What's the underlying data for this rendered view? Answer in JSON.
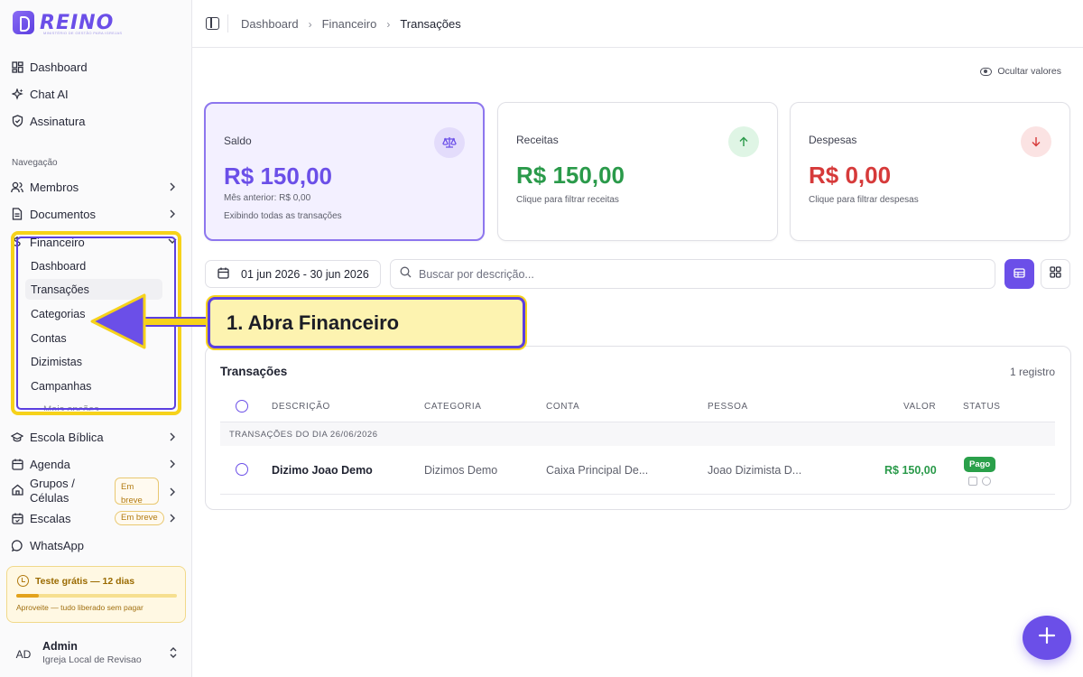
{
  "app": {
    "logo_text": "REINO",
    "logo_sub": "MINISTÉRIO DE GESTÃO PARA IGREJAS"
  },
  "sidebar": {
    "top_items": [
      {
        "label": "Dashboard",
        "icon": "grid-icon"
      },
      {
        "label": "Chat AI",
        "icon": "sparkles-icon"
      },
      {
        "label": "Assinatura",
        "icon": "shield-check-icon"
      }
    ],
    "section_label": "Navegação",
    "nav_items": [
      {
        "label": "Membros",
        "icon": "users-icon"
      },
      {
        "label": "Documentos",
        "icon": "file-icon"
      },
      {
        "label": "Financeiro",
        "icon": "dollar-icon"
      }
    ],
    "financeiro_sub": [
      {
        "label": "Dashboard"
      },
      {
        "label": "Transações"
      },
      {
        "label": "Categorias"
      },
      {
        "label": "Contas"
      },
      {
        "label": "Dizimistas"
      },
      {
        "label": "Campanhas"
      }
    ],
    "sub_faded": "Mais opções",
    "lower_items": [
      {
        "label": "Escola Bíblica",
        "icon": "graduation-cap-icon"
      },
      {
        "label": "Agenda",
        "icon": "calendar-icon"
      },
      {
        "label": "Grupos / Células",
        "icon": "home-icon",
        "badge": "Em breve"
      },
      {
        "label": "Escalas",
        "icon": "calendar-check-icon",
        "badge": "Em breve"
      },
      {
        "label": "WhatsApp",
        "icon": "whatsapp-icon"
      }
    ],
    "trial": {
      "title": "Teste grátis — 12 dias",
      "subtitle": "Aproveite — tudo liberado sem pagar",
      "progress": 0.14
    },
    "user": {
      "initials": "AD",
      "name": "Admin",
      "org": "Igreja Local de Revisao"
    }
  },
  "topbar": {
    "breadcrumb": [
      "Dashboard",
      "Financeiro",
      "Transações"
    ]
  },
  "hide_values_label": "Ocultar valores",
  "cards": {
    "balance": {
      "label": "Saldo",
      "value": "R$ 150,00",
      "note1": "Mês anterior: R$ 0,00",
      "note2": "Exibindo todas as transações"
    },
    "income": {
      "label": "Receitas",
      "value": "R$ 150,00",
      "note": "Clique para filtrar receitas"
    },
    "expense": {
      "label": "Despesas",
      "value": "R$ 0,00",
      "note": "Clique para filtrar despesas"
    }
  },
  "filters": {
    "date_range": "01 jun 2026 - 30 jun 2026",
    "search_placeholder": "Buscar por descrição..."
  },
  "callout": "1. Abra Financeiro",
  "table": {
    "title": "Transações",
    "count": "1 registro",
    "columns": [
      "DESCRIÇÃO",
      "CATEGORIA",
      "CONTA",
      "PESSOA",
      "VALOR",
      "STATUS"
    ],
    "group_label": "TRANSAÇÕES DO DIA 26/06/2026",
    "rows": [
      {
        "description": "Dizimo Joao Demo",
        "category": "Dizimos Demo",
        "account": "Caixa Principal De...",
        "person": "Joao Dizimista D...",
        "value": "R$ 150,00",
        "status": "Pago"
      }
    ]
  },
  "colors": {
    "accent": "#6b4fe8",
    "income": "#2a9a4a",
    "expense": "#d63a3a",
    "highlight": "#f6d21a"
  }
}
